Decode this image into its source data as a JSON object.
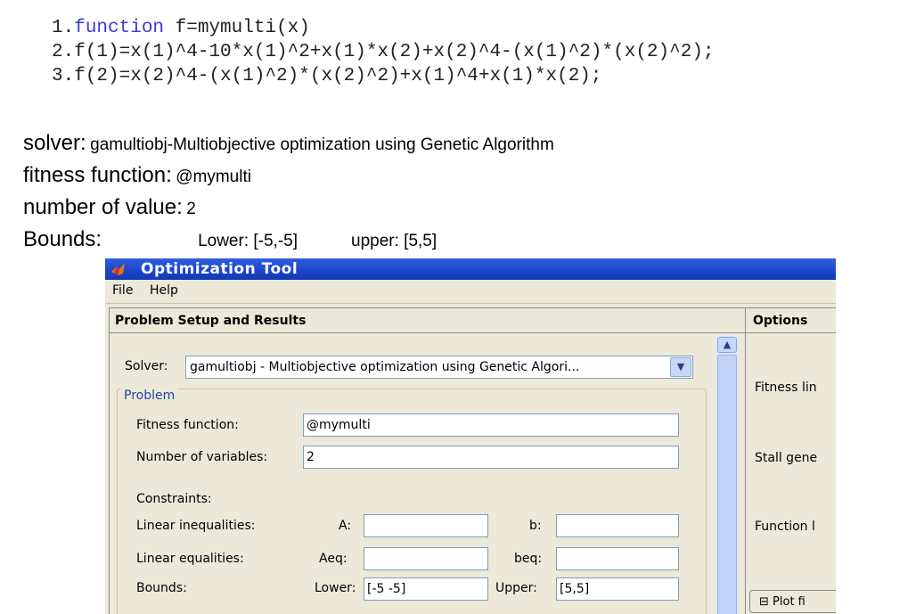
{
  "code": {
    "lines": [
      {
        "num": "1.",
        "kw": "function",
        "text": " f=mymulti(x)"
      },
      {
        "num": "2.",
        "kw": "",
        "text": "f(1)=x(1)^4-10*x(1)^2+x(1)*x(2)+x(2)^4-(x(1)^2)*(x(2)^2);"
      },
      {
        "num": "3.",
        "kw": "",
        "text": "f(2)=x(2)^4-(x(1)^2)*(x(2)^2)+x(1)^4+x(1)*x(2);"
      }
    ]
  },
  "info": {
    "solver_label": "solver:",
    "solver_value": "gamultiobj-Multiobjective optimization using Genetic Algorithm",
    "fitness_label": "fitness function:",
    "fitness_value": "@mymulti",
    "count_label": "number of value:",
    "count_value": "2",
    "bounds_label": "Bounds:",
    "lower_text": "Lower: [-5,-5]",
    "upper_text": "upper: [5,5]"
  },
  "window": {
    "title": "Optimization Tool",
    "menu": [
      "File",
      "Help"
    ],
    "left_panel_title": "Problem Setup and Results",
    "right_panel_title": "Options",
    "solver_label": "Solver:",
    "solver_value": "gamultiobj - Multiobjective optimization using Genetic Algori...",
    "problem_group": "Problem",
    "fitness_label": "Fitness function:",
    "fitness_value": "@mymulti",
    "nvars_label": "Number of variables:",
    "nvars_value": "2",
    "constraints_label": "Constraints:",
    "lin_ineq_label": "Linear inequalities:",
    "a_label": "A:",
    "b_label": "b:",
    "lin_eq_label": "Linear equalities:",
    "aeq_label": "Aeq:",
    "beq_label": "beq:",
    "bounds_label": "Bounds:",
    "lower_label": "Lower:",
    "lower_value": "[-5 -5]",
    "upper_label": "Upper:",
    "upper_value": "[5,5]",
    "options_items": [
      "Fitness lin",
      "Stall gene",
      "Function l"
    ],
    "plot_button": "Plot fi",
    "plot_toggle": "⊟"
  },
  "colors": {
    "titlebar": "#1a44c8",
    "keyword": "#3b3bd6",
    "group_title": "#2044a8"
  }
}
